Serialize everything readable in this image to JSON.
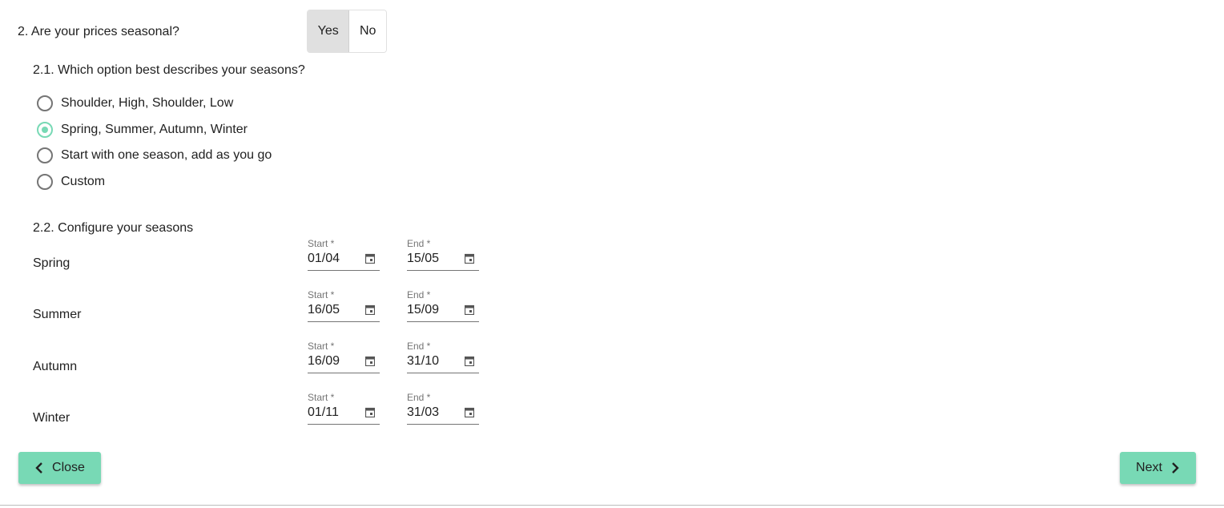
{
  "question2": {
    "label": "2. Are your prices seasonal?",
    "options": [
      "Yes",
      "No"
    ],
    "selected": "Yes"
  },
  "question21": {
    "label": "2.1. Which option best describes your seasons?",
    "options": [
      {
        "label": "Shoulder, High, Shoulder, Low",
        "checked": false
      },
      {
        "label": "Spring, Summer, Autumn, Winter",
        "checked": true
      },
      {
        "label": "Start with one season, add as you go",
        "checked": false
      },
      {
        "label": "Custom",
        "checked": false
      }
    ]
  },
  "question22": {
    "label": "2.2. Configure your seasons",
    "start_label": "Start *",
    "end_label": "End *",
    "seasons": [
      {
        "name": "Spring",
        "start": "01/04",
        "end": "15/05"
      },
      {
        "name": "Summer",
        "start": "16/05",
        "end": "15/09"
      },
      {
        "name": "Autumn",
        "start": "16/09",
        "end": "31/10"
      },
      {
        "name": "Winter",
        "start": "01/11",
        "end": "31/03"
      }
    ]
  },
  "footer": {
    "close_label": "Close",
    "next_label": "Next"
  },
  "colors": {
    "accent": "#78d9b5",
    "selected_toggle": "#e0e0e0"
  },
  "icons": [
    "calendar-icon",
    "chevron-left-icon",
    "chevron-right-icon"
  ]
}
